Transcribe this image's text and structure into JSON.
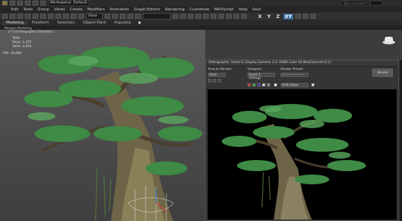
{
  "quickbar": {
    "workspace": "Workspace: Default",
    "search_placeholder": "Type a keyword or phrase"
  },
  "menubar": {
    "items": [
      "Edit",
      "Tools",
      "Group",
      "Views",
      "Create",
      "Modifiers",
      "Animation",
      "Graph Editors",
      "Rendering",
      "Customize",
      "MAXScript",
      "Help",
      "Saut"
    ]
  },
  "toolbar": {
    "view_dropdown": "View",
    "axes": [
      "X",
      "Y",
      "Z",
      "XY"
    ],
    "active_axis": "XY"
  },
  "ribbon": {
    "tabs": [
      "Modeling",
      "Freeform",
      "Selection",
      "Object Paint",
      "Populate"
    ],
    "active_tab": "Modeling",
    "sub_label": "Polygon Modeling"
  },
  "viewport": {
    "label": "[+] [Orthographic] [Realistic]",
    "stats": {
      "title": "Total",
      "polys_label": "Polys:",
      "polys_value": "1,375",
      "verts_label": "Verts:",
      "verts_value": "2,953"
    },
    "fps_label": "FPS:",
    "fps_value": "18.000"
  },
  "render_window": {
    "title": "Orthographic, frame 0, Display Gamma: 2.2, RGBA Color 16 Bits/Channel (1:1)",
    "area_label": "Area to Render:",
    "area_value": "View",
    "viewport_label": "Viewport:",
    "viewport_value": "Quad 4 - Orthogr",
    "preset_label": "Render Preset:",
    "preset_value": "-------------------",
    "render_button": "Render",
    "channel_value": "RGB Alpha"
  },
  "colors": {
    "accent": "#3b6ea5",
    "viewport_bg": "#4a4a4a",
    "render_bg": "#000000",
    "tree_green": "#3f8a45",
    "trunk": "#6e6548"
  }
}
